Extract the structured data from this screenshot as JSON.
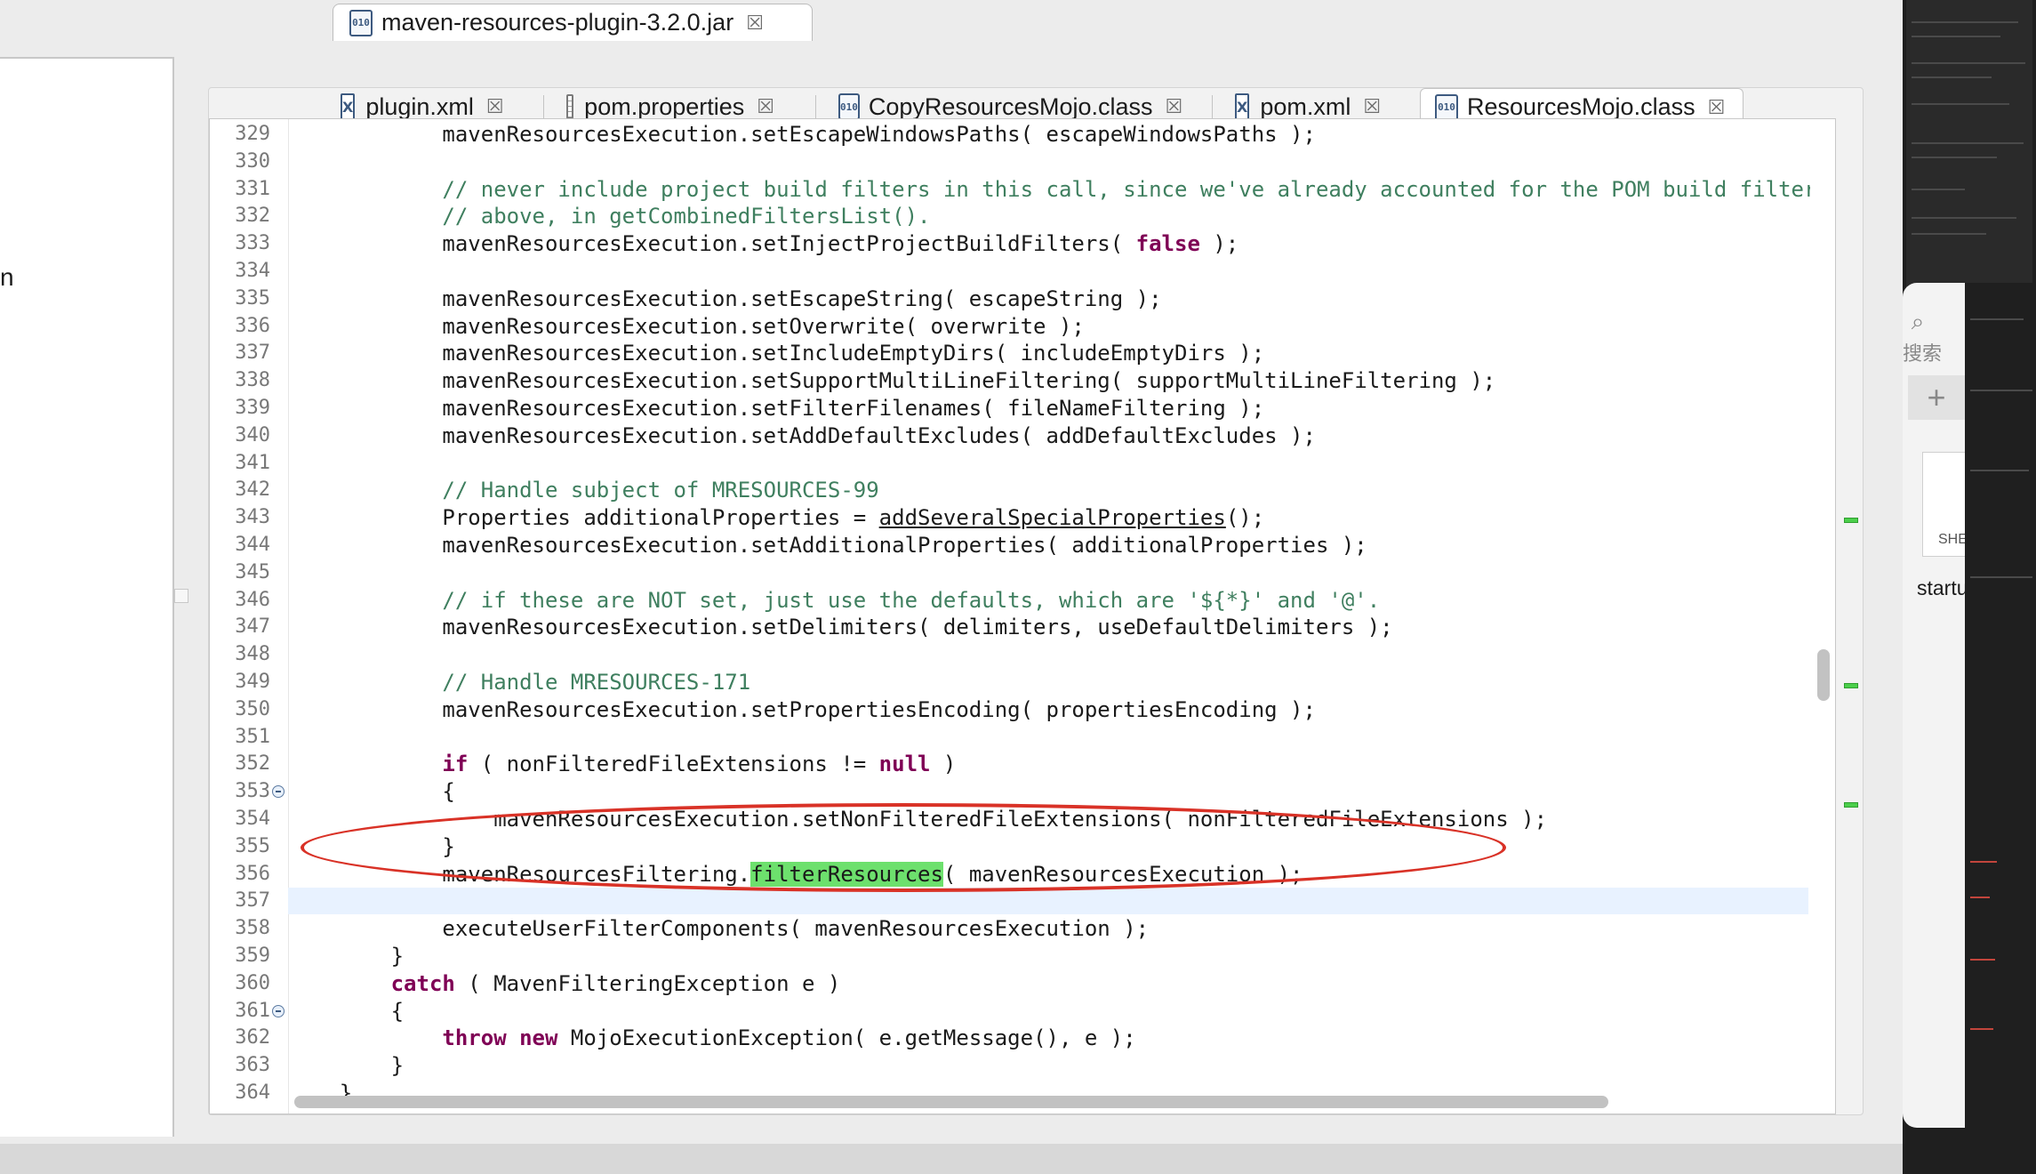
{
  "window": {
    "jar_tab": {
      "title": "maven-resources-plugin-3.2.0.jar",
      "icon": "class-file-icon"
    }
  },
  "editor": {
    "tabs": [
      {
        "label": "plugin.xml",
        "icon": "xml-file-icon",
        "active": false
      },
      {
        "label": "pom.properties",
        "icon": "properties-file-icon",
        "active": false
      },
      {
        "label": "CopyResourcesMojo.class",
        "icon": "class-file-icon",
        "active": false
      },
      {
        "label": "pom.xml",
        "icon": "xml-file-icon",
        "active": false
      },
      {
        "label": "ResourcesMojo.class",
        "icon": "class-file-icon",
        "active": true
      }
    ],
    "lines": [
      {
        "n": "329",
        "parts": [
          {
            "t": "            mavenResourcesExecution.setEscapeWindowsPaths( escapeWindowsPaths );"
          }
        ]
      },
      {
        "n": "330",
        "parts": []
      },
      {
        "n": "331",
        "parts": [
          {
            "t": "            "
          },
          {
            "t": "// never include project build filters in this call, since we've already accounted for the POM build filters",
            "s": "cm"
          }
        ]
      },
      {
        "n": "332",
        "parts": [
          {
            "t": "            "
          },
          {
            "t": "// above, in getCombinedFiltersList().",
            "s": "cm"
          }
        ]
      },
      {
        "n": "333",
        "parts": [
          {
            "t": "            mavenResourcesExecution.setInjectProjectBuildFilters( "
          },
          {
            "t": "false",
            "s": "kw"
          },
          {
            "t": " );"
          }
        ]
      },
      {
        "n": "334",
        "parts": []
      },
      {
        "n": "335",
        "parts": [
          {
            "t": "            mavenResourcesExecution.setEscapeString( escapeString );"
          }
        ]
      },
      {
        "n": "336",
        "parts": [
          {
            "t": "            mavenResourcesExecution.setOverwrite( overwrite );"
          }
        ]
      },
      {
        "n": "337",
        "parts": [
          {
            "t": "            mavenResourcesExecution.setIncludeEmptyDirs( includeEmptyDirs );"
          }
        ]
      },
      {
        "n": "338",
        "parts": [
          {
            "t": "            mavenResourcesExecution.setSupportMultiLineFiltering( supportMultiLineFiltering );"
          }
        ]
      },
      {
        "n": "339",
        "parts": [
          {
            "t": "            mavenResourcesExecution.setFilterFilenames( fileNameFiltering );"
          }
        ]
      },
      {
        "n": "340",
        "parts": [
          {
            "t": "            mavenResourcesExecution.setAddDefaultExcludes( addDefaultExcludes );"
          }
        ]
      },
      {
        "n": "341",
        "parts": []
      },
      {
        "n": "342",
        "parts": [
          {
            "t": "            "
          },
          {
            "t": "// Handle subject of MRESOURCES-99",
            "s": "cm"
          }
        ]
      },
      {
        "n": "343",
        "parts": [
          {
            "t": "            Properties additionalProperties = "
          },
          {
            "t": "addSeveralSpecialProperties",
            "s": "ul"
          },
          {
            "t": "();"
          }
        ]
      },
      {
        "n": "344",
        "parts": [
          {
            "t": "            mavenResourcesExecution.setAdditionalProperties( additionalProperties );"
          }
        ]
      },
      {
        "n": "345",
        "parts": []
      },
      {
        "n": "346",
        "parts": [
          {
            "t": "            "
          },
          {
            "t": "// if these are NOT set, just use the defaults, which are '${*}' and '@'.",
            "s": "cm"
          }
        ]
      },
      {
        "n": "347",
        "parts": [
          {
            "t": "            mavenResourcesExecution.setDelimiters( delimiters, useDefaultDelimiters );"
          }
        ]
      },
      {
        "n": "348",
        "parts": []
      },
      {
        "n": "349",
        "parts": [
          {
            "t": "            "
          },
          {
            "t": "// Handle MRESOURCES-171",
            "s": "cm"
          }
        ]
      },
      {
        "n": "350",
        "parts": [
          {
            "t": "            mavenResourcesExecution.setPropertiesEncoding( propertiesEncoding );"
          }
        ]
      },
      {
        "n": "351",
        "parts": []
      },
      {
        "n": "352",
        "parts": [
          {
            "t": "            "
          },
          {
            "t": "if",
            "s": "kw"
          },
          {
            "t": " ( nonFilteredFileExtensions != "
          },
          {
            "t": "null",
            "s": "kw"
          },
          {
            "t": " )"
          }
        ]
      },
      {
        "n": "353",
        "fold": true,
        "parts": [
          {
            "t": "            {"
          }
        ]
      },
      {
        "n": "354",
        "parts": [
          {
            "t": "                mavenResourcesExecution.setNonFilteredFileExtensions( nonFilteredFileExtensions );"
          }
        ]
      },
      {
        "n": "355",
        "parts": [
          {
            "t": "            }"
          }
        ]
      },
      {
        "n": "356",
        "parts": [
          {
            "t": "            mavenResourcesFiltering."
          },
          {
            "t": "filterResources",
            "s": "hl"
          },
          {
            "t": "( mavenResourcesExecution );"
          }
        ]
      },
      {
        "n": "357",
        "current": true,
        "parts": []
      },
      {
        "n": "358",
        "parts": [
          {
            "t": "            executeUserFilterComponents( mavenResourcesExecution );"
          }
        ]
      },
      {
        "n": "359",
        "parts": [
          {
            "t": "        }"
          }
        ]
      },
      {
        "n": "360",
        "parts": [
          {
            "t": "        "
          },
          {
            "t": "catch",
            "s": "kw"
          },
          {
            "t": " ( MavenFilteringException e )"
          }
        ]
      },
      {
        "n": "361",
        "fold": true,
        "parts": [
          {
            "t": "        {"
          }
        ]
      },
      {
        "n": "362",
        "parts": [
          {
            "t": "            "
          },
          {
            "t": "throw",
            "s": "kw"
          },
          {
            "t": " "
          },
          {
            "t": "new",
            "s": "kw"
          },
          {
            "t": " MojoExecutionException( e.getMessage(), e );"
          }
        ]
      },
      {
        "n": "363",
        "parts": [
          {
            "t": "        }"
          }
        ]
      },
      {
        "n": "364",
        "parts": [
          {
            "t": "    }"
          }
        ]
      }
    ]
  },
  "left_pane": {
    "stub_text": "n"
  },
  "side_panel": {
    "search_label": "搜索",
    "add_label": "+",
    "thumb_label": "SHE",
    "file_label": "startu"
  },
  "colors": {
    "keyword": "#7f0055",
    "comment": "#3f7f5f",
    "occurrence_highlight": "#6de06d",
    "annotation_circle": "#d93227",
    "current_line": "#e8f2ff"
  }
}
